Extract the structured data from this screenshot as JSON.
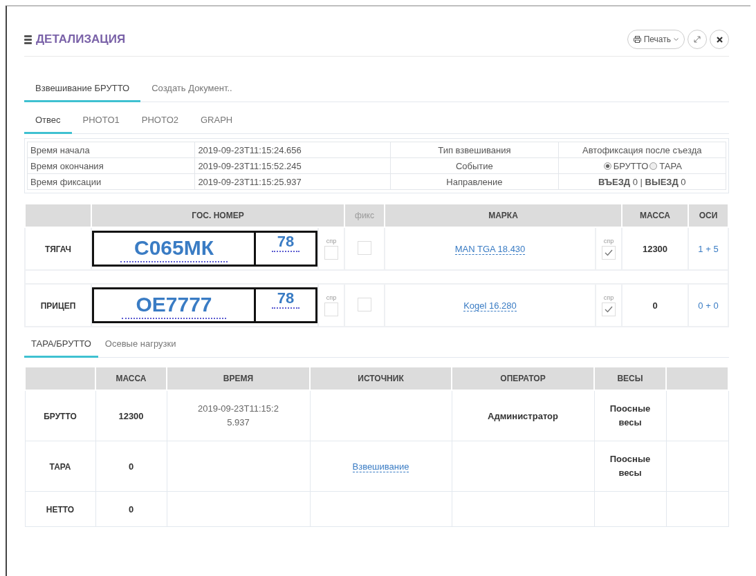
{
  "window": {
    "title": "ДЕТАЛИЗАЦИЯ",
    "print_button": "Печать"
  },
  "tabs": [
    {
      "label": "Взвешивание БРУТТО",
      "selected": true
    },
    {
      "label": "Создать Документ..",
      "selected": false
    }
  ],
  "subtabs": [
    {
      "label": "Отвес",
      "selected": true
    },
    {
      "label": "PHOTO1",
      "selected": false
    },
    {
      "label": "PHOTO2",
      "selected": false
    },
    {
      "label": "GRAPH",
      "selected": false
    }
  ],
  "info": [
    {
      "label": "Время начала",
      "value": "2019-09-23T11:15:24.656",
      "label2": "Тип взвешивания",
      "kind": "text",
      "value2": "Автофиксация после съезда"
    },
    {
      "label": "Время окончания",
      "value": "2019-09-23T11:15:52.245",
      "label2": "Событие",
      "kind": "radio",
      "options": [
        {
          "label": "БРУТТО",
          "selected": true
        },
        {
          "label": "ТАРА",
          "selected": false
        }
      ]
    },
    {
      "label": "Время фиксации",
      "value": "2019-09-23T11:15:25.937",
      "label2": "Направление",
      "kind": "rich",
      "value2": "**ВЪЕЗД** 0 | **ВЫЕЗД** 0"
    }
  ],
  "vehicles": {
    "columns": [
      "ГОС. НОМЕР",
      "фикс",
      "МАРКА",
      "МАССА",
      "ОСИ"
    ],
    "rows": [
      {
        "label": "ТЯГАЧ",
        "plate": "С065МК",
        "region": "78",
        "spr_label": "спр",
        "spr_checked": false,
        "fix_checked": false,
        "brand": "MAN TGA 18.430",
        "brand_spr_label": "спр",
        "brand_spr_checked": true,
        "mass": "12300",
        "axles": "1 + 5"
      },
      {
        "label": "ПРИЦЕП",
        "plate": "ОЕ7777",
        "region": "78",
        "spr_label": "спр",
        "spr_checked": false,
        "fix_checked": false,
        "brand": "Kogel 16.280",
        "brand_spr_label": "спр",
        "brand_spr_checked": true,
        "mass": "0",
        "axles": "0 + 0"
      }
    ]
  },
  "bottom_tabs": [
    {
      "label": "ТАРА/БРУТТО",
      "selected": true
    },
    {
      "label": "Осевые нагрузки",
      "selected": false
    }
  ],
  "weights": {
    "columns": [
      "МАССА",
      "ВРЕМЯ",
      "ИСТОЧНИК",
      "ОПЕРАТОР",
      "ВЕСЫ"
    ],
    "rows": [
      {
        "label": "БРУТТО",
        "mass": "12300",
        "time": "2019-09-23T11:15:25.937",
        "operator": "Администратор",
        "scales": "Поосные весы"
      },
      {
        "label": "ТАРА",
        "mass": "0",
        "source": "Взвешивание",
        "scales": "Поосные весы"
      },
      {
        "label": "НЕТТО",
        "mass": "0"
      }
    ]
  }
}
